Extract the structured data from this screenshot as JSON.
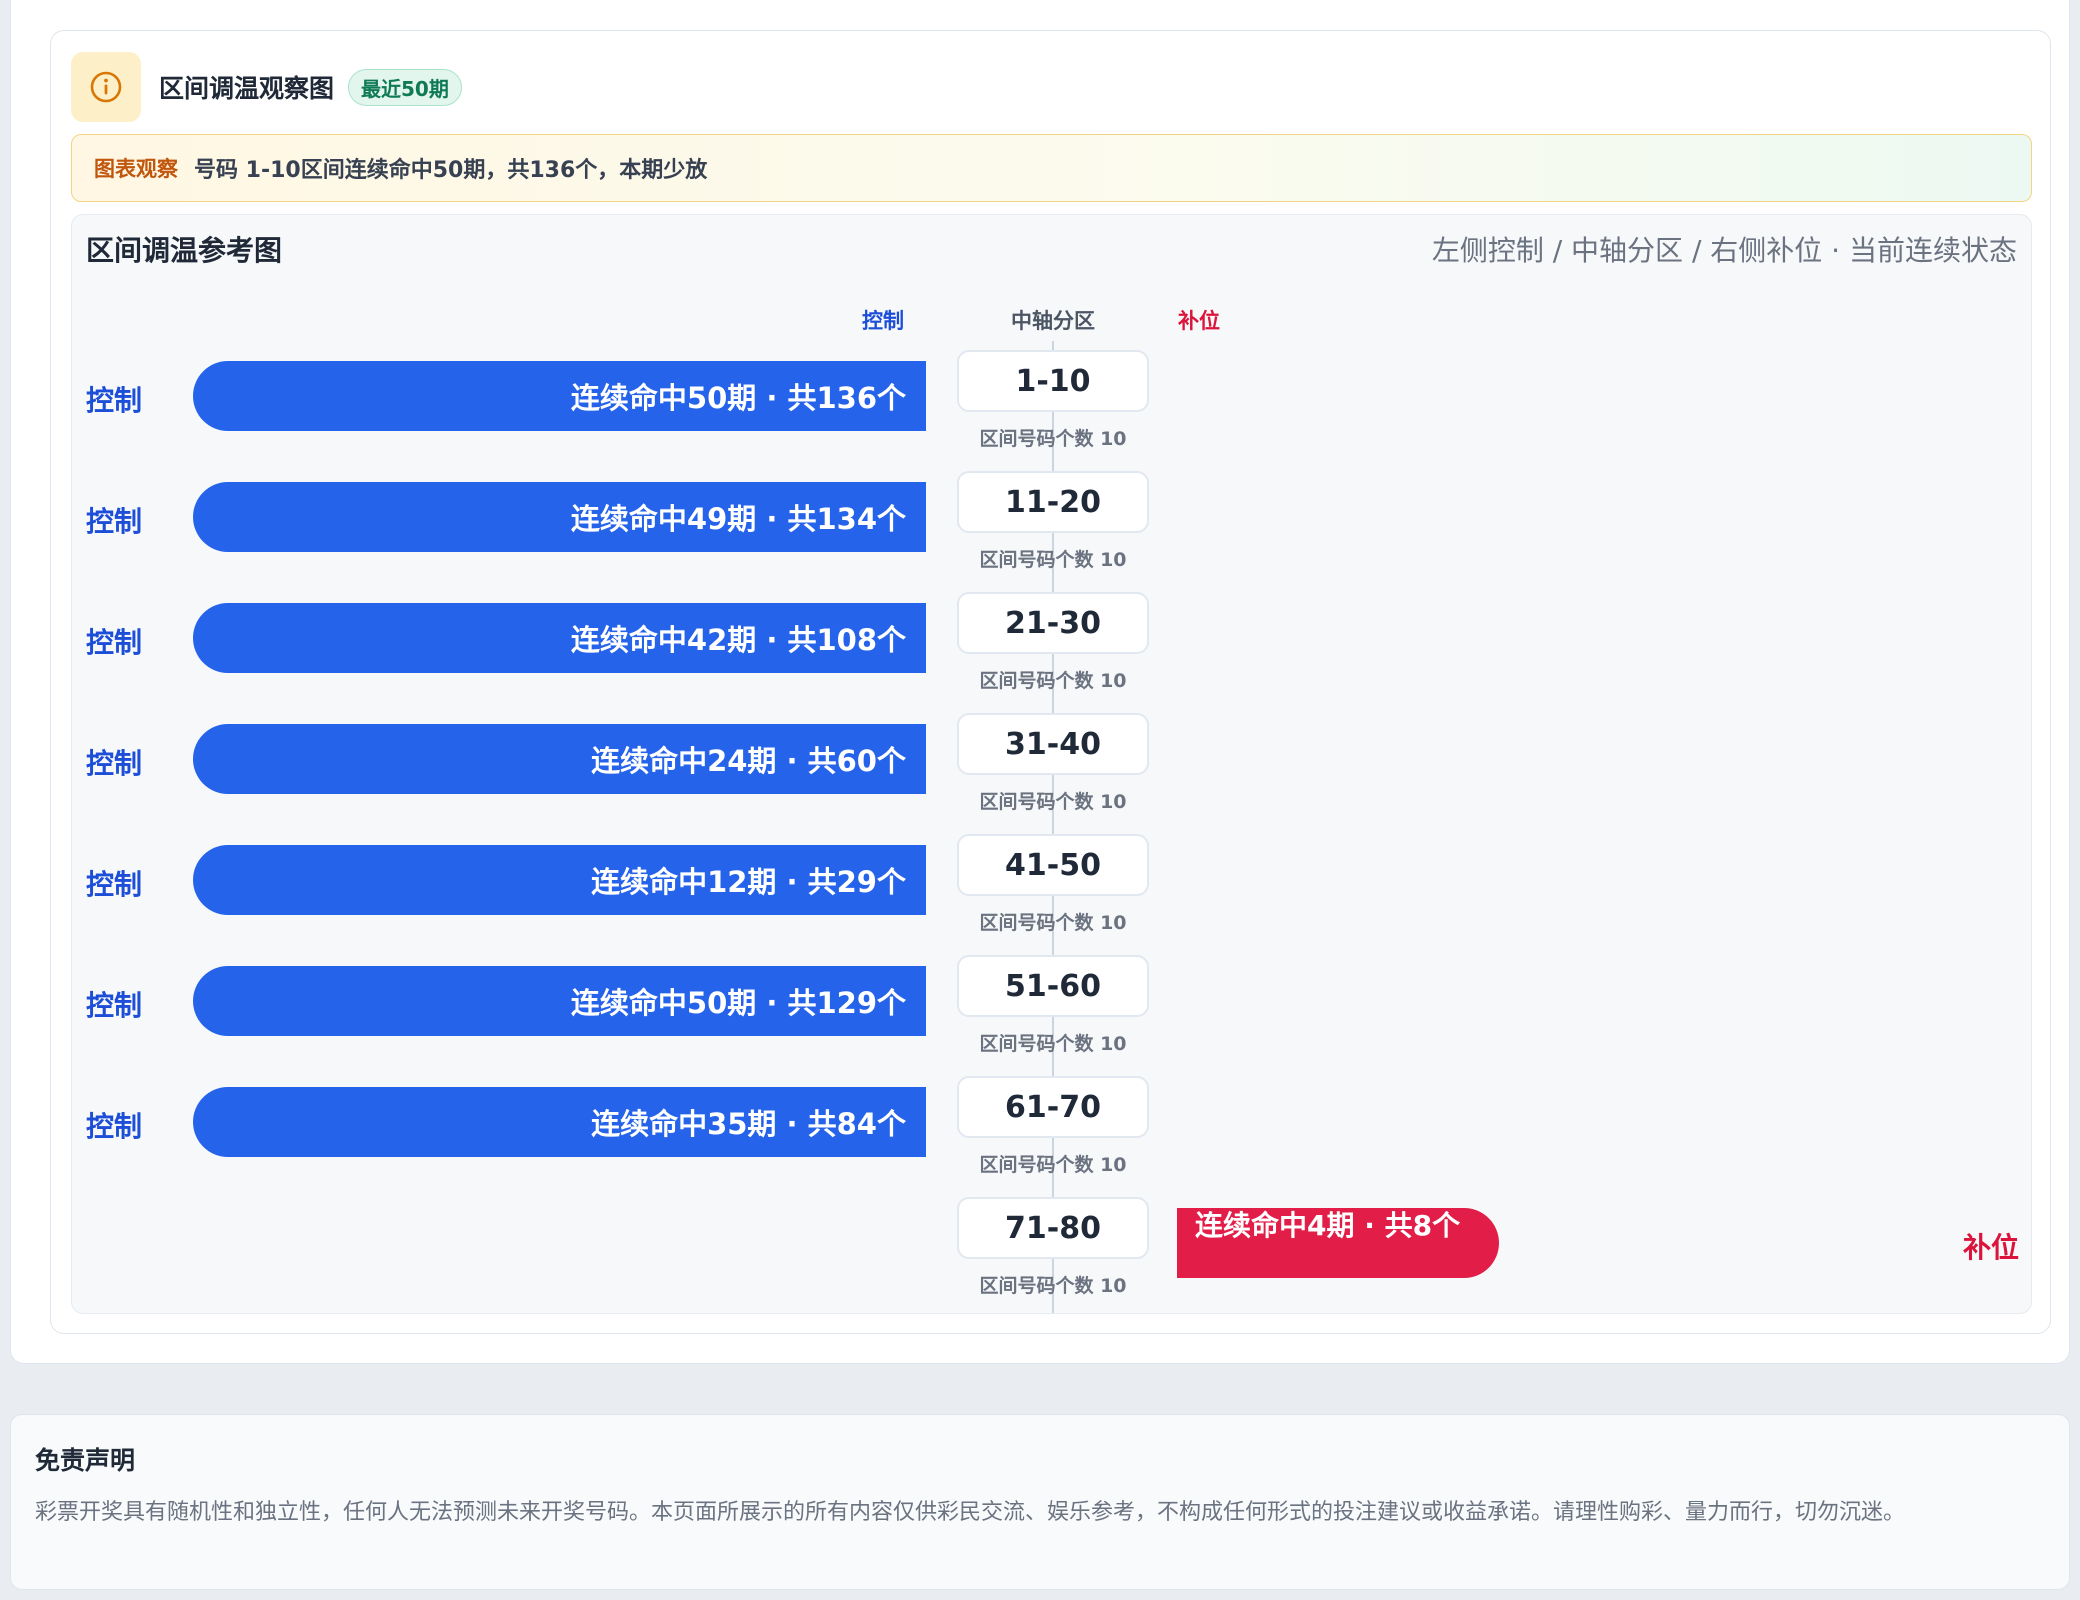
{
  "header": {
    "title": "区间调温观察图",
    "badge": "最近50期",
    "icon": "info-circle-icon",
    "icon_color": "#d97706"
  },
  "observation": {
    "tag": "图表观察",
    "text": "号码 1-10区间连续命中50期，共136个，本期少放"
  },
  "chart_data": {
    "type": "bar",
    "title": "区间调温参考图",
    "legend_text": "左侧控制 / 中轴分区 / 右侧补位 · 当前连续状态",
    "columns": {
      "left": "控制",
      "center": "中轴分区",
      "right": "补位"
    },
    "colors": {
      "control": "#2563eb",
      "fill": "#e11d48"
    },
    "zone_caption": "区间号码个数 10",
    "rows": [
      {
        "zone": "1-10",
        "side": "控制",
        "label": "连续命中50期 · 共136个",
        "streak": 50,
        "total": 136
      },
      {
        "zone": "11-20",
        "side": "控制",
        "label": "连续命中49期 · 共134个",
        "streak": 49,
        "total": 134
      },
      {
        "zone": "21-30",
        "side": "控制",
        "label": "连续命中42期 · 共108个",
        "streak": 42,
        "total": 108
      },
      {
        "zone": "31-40",
        "side": "控制",
        "label": "连续命中24期 · 共60个",
        "streak": 24,
        "total": 60
      },
      {
        "zone": "41-50",
        "side": "控制",
        "label": "连续命中12期 · 共29个",
        "streak": 12,
        "total": 29
      },
      {
        "zone": "51-60",
        "side": "控制",
        "label": "连续命中50期 · 共129个",
        "streak": 50,
        "total": 129
      },
      {
        "zone": "61-70",
        "side": "控制",
        "label": "连续命中35期 · 共84个",
        "streak": 35,
        "total": 84
      },
      {
        "zone": "71-80",
        "side": "补位",
        "label": "连续命中4期 · 共8个",
        "streak": 4,
        "total": 8
      }
    ]
  },
  "disclaimer": {
    "title": "免责声明",
    "text": "彩票开奖具有随机性和独立性，任何人无法预测未来开奖号码。本页面所展示的所有内容仅供彩民交流、娱乐参考，不构成任何形式的投注建议或收益承诺。请理性购彩、量力而行，切勿沉迷。"
  }
}
